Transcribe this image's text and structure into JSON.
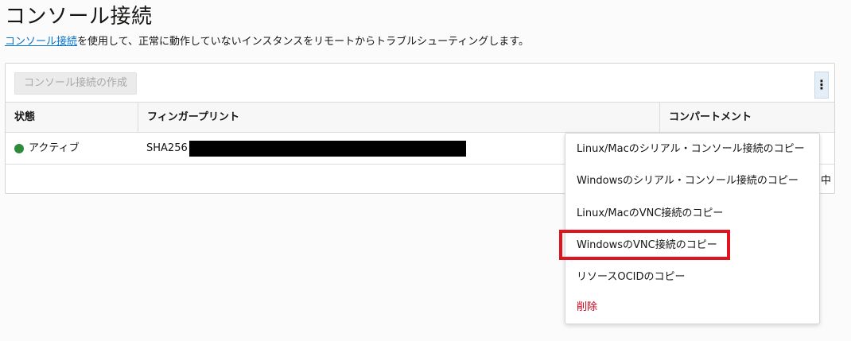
{
  "page": {
    "title": "コンソール接続",
    "description_link": "コンソール接続",
    "description_rest": "を使用して、正常に動作していないインスタンスをリモートからトラブルシューティングします。"
  },
  "toolbar": {
    "create_label": "コンソール接続の作成"
  },
  "table": {
    "columns": [
      "状態",
      "フィンガープリント",
      "コンパートメント"
    ],
    "rows": [
      {
        "status": "アクティブ",
        "fingerprint_prefix": "SHA256",
        "status_color": "#2f8a3b"
      }
    ],
    "partial_text": "中"
  },
  "actions_menu": {
    "kebab_label": "⋮",
    "items": [
      "Linux/Macのシリアル・コンソール接続のコピー",
      "Windowsのシリアル・コンソール接続のコピー",
      "Linux/MacのVNC接続のコピー",
      "WindowsのVNC接続のコピー",
      "リソースOCIDのコピー",
      "削除"
    ],
    "highlight_color": "#e0141e",
    "danger_color": "#d0021b"
  }
}
